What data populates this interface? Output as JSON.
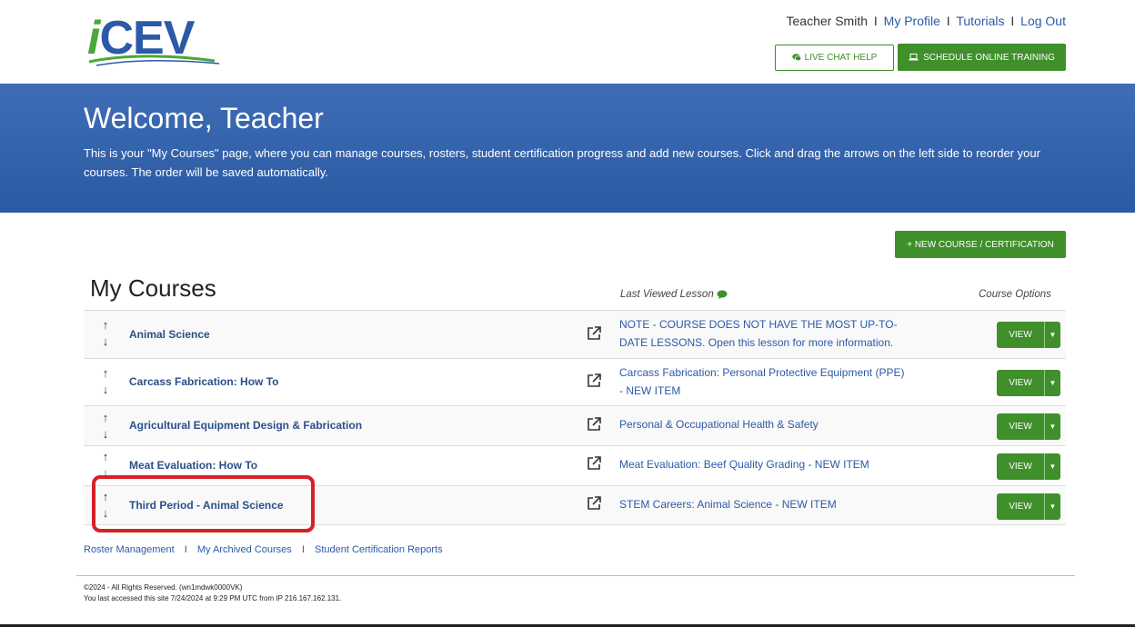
{
  "header": {
    "logo_text_i": "i",
    "logo_text_cev": "CEV",
    "user_name": "Teacher Smith",
    "links": {
      "my_profile": "My Profile",
      "tutorials": "Tutorials",
      "log_out": "Log Out"
    },
    "separator": "I",
    "chat_button": "LIVE CHAT HELP",
    "training_button": "SCHEDULE ONLINE TRAINING"
  },
  "banner": {
    "title": "Welcome, Teacher",
    "description": "This is your \"My Courses\" page, where you can manage courses, rosters, student certification progress and add new courses. Click and drag the arrows on the left side to reorder your courses. The order will be saved automatically."
  },
  "new_course_button": "+ NEW COURSE / CERTIFICATION",
  "courses": {
    "title": "My Courses",
    "last_viewed_header": "Last Viewed Lesson",
    "options_header": "Course Options",
    "view_label": "VIEW",
    "rows": [
      {
        "name": "Animal Science",
        "lesson": "NOTE - COURSE DOES NOT HAVE THE MOST UP-TO-DATE LESSONS. Open this lesson for more information."
      },
      {
        "name": "Carcass Fabrication: How To",
        "lesson": "Carcass Fabrication: Personal Protective Equipment (PPE) - NEW ITEM"
      },
      {
        "name": "Agricultural Equipment Design & Fabrication",
        "lesson": "Personal & Occupational Health & Safety"
      },
      {
        "name": "Meat Evaluation: How To",
        "lesson": "Meat Evaluation: Beef Quality Grading - NEW ITEM"
      },
      {
        "name": "Third Period - Animal Science",
        "lesson": "STEM Careers: Animal Science - NEW ITEM"
      }
    ]
  },
  "footer": {
    "roster_management": "Roster Management",
    "archived_courses": "My Archived Courses",
    "certification_reports": "Student Certification Reports",
    "separator": "I",
    "copyright": "©2024 - All Rights Reserved. (wn1mdwk0000VK)",
    "last_access": "You last accessed this site 7/24/2024 at 9:29 PM UTC from IP 216.167.162.131."
  },
  "colors": {
    "brand_green": "#3f8f2a",
    "brand_blue": "#2b5aa8",
    "highlight_red": "#d82027"
  }
}
